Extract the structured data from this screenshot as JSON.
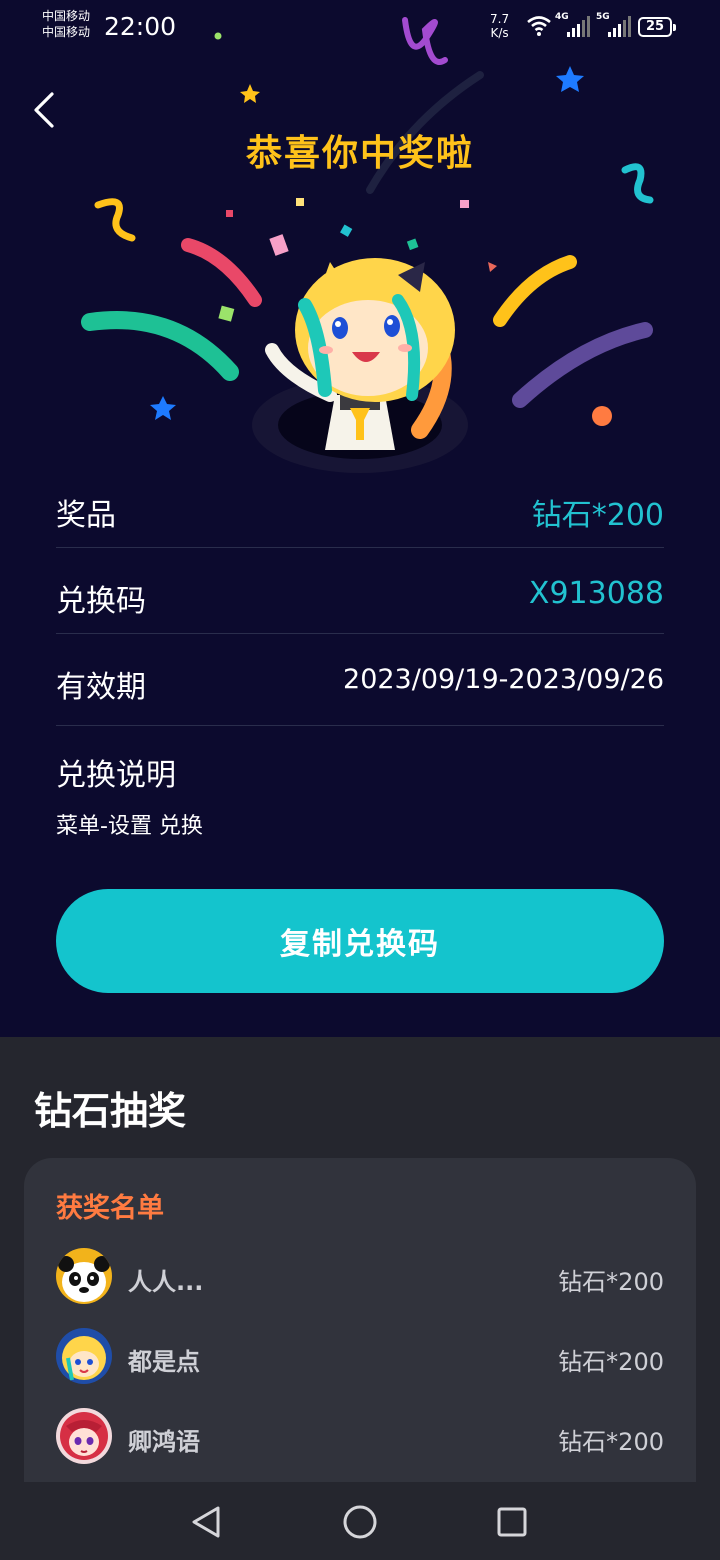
{
  "status_bar": {
    "carrier_1": "中国移动",
    "carrier_2": "中国移动",
    "time": "22:00",
    "net_speed_value": "7.7",
    "net_speed_unit": "K/s",
    "signal_1_label": "4G",
    "signal_2_label": "5G",
    "battery": "25"
  },
  "header": {
    "title": "恭喜你中奖啦"
  },
  "prize_info": {
    "prize_label": "奖品",
    "prize_value": "钻石*200",
    "code_label": "兑换码",
    "code_value": "X913088",
    "validity_label": "有效期",
    "validity_value": "2023/09/19-2023/09/26",
    "instructions_label": "兑换说明",
    "instructions_text": "菜单-设置 兑换"
  },
  "copy_button_label": "复制兑换码",
  "lottery": {
    "title": "钻石抽奖",
    "winners_title": "获奖名单",
    "winners": [
      {
        "name": "人人...",
        "prize": "钻石*200"
      },
      {
        "name": "都是点",
        "prize": "钻石*200"
      },
      {
        "name": "卿鸿语",
        "prize": "钻石*200"
      }
    ]
  },
  "colors": {
    "panel_bg": "#0c0a2e",
    "title_gold": "#ffc21a",
    "teal_accent": "#14c4cd",
    "winners_orange": "#ff7b41"
  },
  "icons": [
    "back-arrow-icon",
    "wifi-icon",
    "signal-icon",
    "battery-icon",
    "nav-back-icon",
    "nav-home-icon",
    "nav-recents-icon"
  ]
}
